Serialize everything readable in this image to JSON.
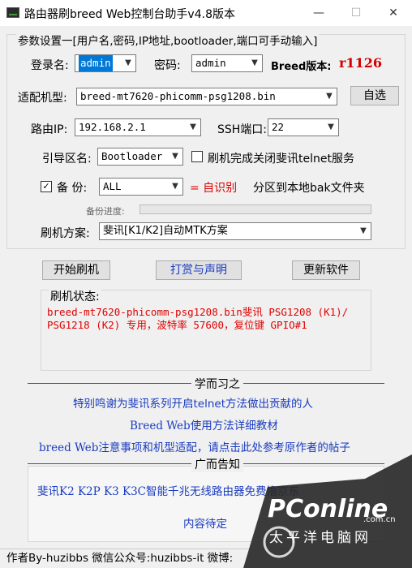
{
  "window": {
    "title": "路由器刷breed Web控制台助手v4.8版本",
    "min": "—",
    "max": "☐",
    "close": "✕"
  },
  "settings": {
    "legend": "参数设置一[用户名,密码,IP地址,bootloader,端口可手动输入]",
    "login_label": "登录名:",
    "login_value": "admin",
    "password_label": "密码:",
    "password_value": "admin",
    "breed_label": "Breed版本:",
    "breed_version": "r1126",
    "model_label": "适配机型:",
    "model_value": "breed-mt7620-phicomm-psg1208.bin",
    "custom_button": "自选",
    "ip_label": "路由IP:",
    "ip_value": "192.168.2.1",
    "ssh_label": "SSH端口:",
    "ssh_value": "22",
    "boot_label": "引导区名:",
    "boot_value": "Bootloader",
    "telnet_label": "刷机完成关闭斐讯telnet服务",
    "backup_label": "备 份:",
    "backup_value": "ALL",
    "auto_text": "= 自识别",
    "backup_suffix": "分区到本地bak文件夹",
    "progress_label": "备份进度:",
    "progress_fraction": 0,
    "scheme_label": "刷机方案:",
    "scheme_value": "斐讯[K1/K2]自动MTK方案"
  },
  "actions": {
    "start": "开始刷机",
    "reward": "打赏与声明",
    "update": "更新软件"
  },
  "status": {
    "legend": "刷机状态:",
    "text": "breed-mt7620-phicomm-psg1208.bin斐讯 PSG1208 (K1)/ PSG1218 (K2) 专用，波特率 57600，复位键 GPIO#1"
  },
  "learn": {
    "title": "学而习之",
    "link1": "特别鸣谢为斐讯系列开启telnet方法做出贡献的人",
    "link2": "Breed Web使用方法详细教材",
    "link3": "breed Web注意事项和机型适配，请点击此处参考原作者的帖子"
  },
  "ads": {
    "title": "广而告知",
    "line1": "斐讯K2 K2P K3 K3C智能千兆无线路由器免费撸京东",
    "line2": "内容待定"
  },
  "footer": {
    "text": "作者By-huzibbs 微信公众号:huzibbs-it 微博:"
  },
  "watermark": {
    "logo": "PConline",
    "com": ".com.cn",
    "sub": "太平洋电脑网"
  },
  "colors": {
    "link": "#1a3cbf",
    "red": "#e00000",
    "selection": "#0078d7",
    "watermark_bg": "#2a2a2a"
  }
}
